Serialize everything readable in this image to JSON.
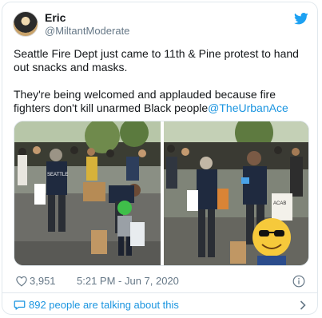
{
  "author": {
    "display_name": "Eric",
    "handle": "@MiltantModerate"
  },
  "tweet": {
    "line1": "Seattle Fire Dept just came to 11th & Pine protest to hand out snacks and masks.",
    "line2": "They're being welcomed and applauded because fire fighters don't kill unarmed Black people",
    "mention": "@TheUrbanAce"
  },
  "media": {
    "left_photo_jacket_text": "SEATTLE",
    "right_photo_sign_text": "ACAB"
  },
  "meta": {
    "likes": "3,951",
    "timestamp": "5:21 PM - Jun 7, 2020"
  },
  "footer": {
    "talking_text": "892 people are talking about this"
  },
  "colors": {
    "link": "#1b95e0",
    "secondary_text": "#657786",
    "border": "#e1e8ed"
  }
}
